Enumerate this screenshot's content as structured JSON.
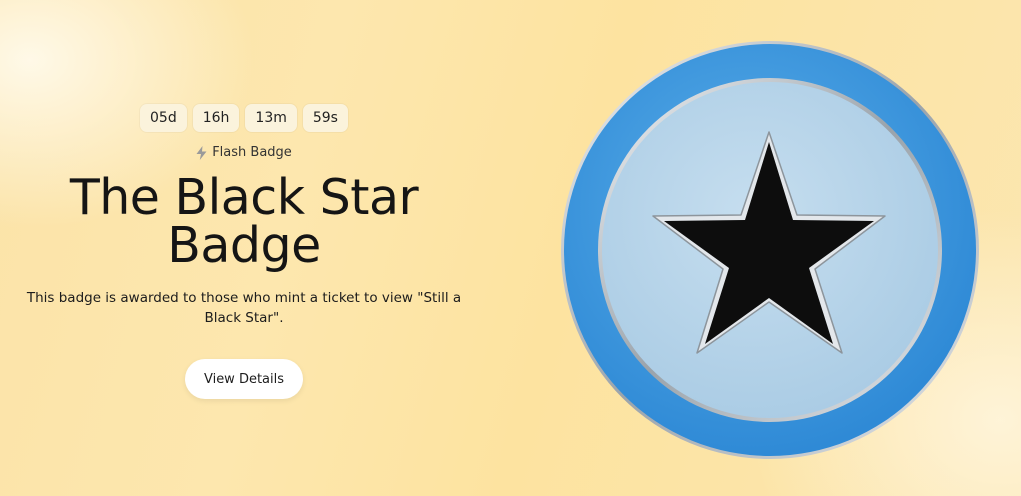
{
  "countdown": {
    "days": "05d",
    "hours": "16h",
    "minutes": "13m",
    "seconds": "59s"
  },
  "badge": {
    "type_label": "Flash Badge",
    "type_icon": "lightning-bolt-icon",
    "title": "The Black Star Badge",
    "description": "This badge is awarded to those who mint a ticket to view \"Still a Black Star\".",
    "cta_label": "View Details"
  },
  "colors": {
    "outer_ring": "#3e9ae0",
    "inner_disc": "#b9d6ea",
    "star": "#0d0d0d",
    "metal": "#d8dde2",
    "background": "#fde3a0"
  }
}
